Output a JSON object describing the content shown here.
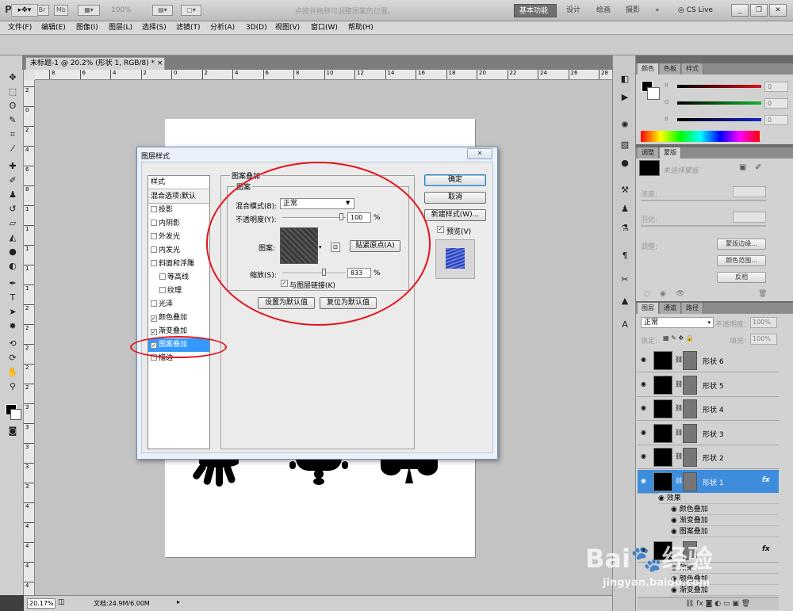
{
  "app": {
    "logo": "Ps",
    "zoom": "100%",
    "workspaces": [
      "基本功能",
      "设计",
      "绘画",
      "摄影",
      "»"
    ],
    "cs_live": "CS Live",
    "window_buttons": [
      "_",
      "❐",
      "✕"
    ]
  },
  "menu": [
    "文件(F)",
    "编辑(E)",
    "图像(I)",
    "图层(L)",
    "选择(S)",
    "滤镜(T)",
    "分析(A)",
    "3D(D)",
    "视图(V)",
    "窗口(W)",
    "帮助(H)"
  ],
  "options": {
    "hint": "点按并拖移可调整图案的位置。"
  },
  "document": {
    "tab_title": "未标题-1 @ 20.2% (形状 1, RGB/8) *",
    "tab_close": "×",
    "ruler_h": [
      "8",
      "6",
      "4",
      "2",
      "0",
      "2",
      "4",
      "6",
      "8",
      "10",
      "12",
      "14",
      "16",
      "18",
      "20",
      "22",
      "24",
      "26",
      "28"
    ],
    "ruler_v": [
      "2",
      "0",
      "2",
      "4",
      "6",
      "8",
      "1",
      "1",
      "1",
      "1",
      "1",
      "2",
      "2",
      "2",
      "2",
      "2",
      "3",
      "3",
      "3",
      "3",
      "3",
      "4",
      "4",
      "4",
      "4",
      "4"
    ],
    "zoom_status": "20.17%",
    "doc_info": "文档:24.9M/6.00M"
  },
  "dialog": {
    "title": "图层样式",
    "close": "✕",
    "styles_header": "样式",
    "blend_default": "混合选项:默认",
    "style_items": [
      {
        "label": "投影",
        "checked": false,
        "indent": false
      },
      {
        "label": "内阴影",
        "checked": false,
        "indent": false
      },
      {
        "label": "外发光",
        "checked": false,
        "indent": false
      },
      {
        "label": "内发光",
        "checked": false,
        "indent": false
      },
      {
        "label": "斜面和浮雕",
        "checked": false,
        "indent": false
      },
      {
        "label": "等高线",
        "checked": false,
        "indent": true
      },
      {
        "label": "纹理",
        "checked": false,
        "indent": true
      },
      {
        "label": "光泽",
        "checked": false,
        "indent": false
      },
      {
        "label": "颜色叠加",
        "checked": true,
        "indent": false
      },
      {
        "label": "渐变叠加",
        "checked": true,
        "indent": false
      },
      {
        "label": "图案叠加",
        "checked": true,
        "indent": false,
        "selected": true
      },
      {
        "label": "描边",
        "checked": false,
        "indent": false
      }
    ],
    "group_title": "图案叠加",
    "subgroup_title": "图案",
    "blend_mode_label": "混合模式(B):",
    "blend_mode_value": "正常",
    "opacity_label": "不透明度(Y):",
    "opacity_value": 100,
    "pattern_label": "图案:",
    "snap_origin": "贴紧原点(A)",
    "scale_label": "缩放(S):",
    "scale_value": 833,
    "percent": "%",
    "link_label": "与图层链接(K)",
    "link_checked": true,
    "set_default": "设置为默认值",
    "reset_default": "复位为默认值",
    "ok": "确定",
    "cancel": "取消",
    "new_style": "新建样式(W)...",
    "preview_label": "预览(V)",
    "preview_checked": true
  },
  "panels": {
    "color_tabs": [
      "颜色",
      "色板",
      "样式"
    ],
    "color_channels": [
      {
        "label": "R",
        "value": "0",
        "color": "#d4151b"
      },
      {
        "label": "G",
        "value": "0",
        "color": "#13b52a"
      },
      {
        "label": "B",
        "value": "0",
        "color": "#1624cc"
      }
    ],
    "adjust_tabs": [
      "调整",
      "蒙版"
    ],
    "mask_hint": "未选择蒙版",
    "density_label": "浓度:",
    "feather_label": "羽化:",
    "refine_label": "调整:",
    "mask_edge": "蒙版边缘...",
    "color_range": "颜色范围...",
    "invert": "反相",
    "layers_tabs": [
      "图层",
      "通道",
      "路径"
    ],
    "layer_blend": "正常",
    "layer_opacity_label": "不透明度:",
    "layer_opacity": "100%",
    "lock_label": "锁定:",
    "fill_label": "填充:",
    "fill_value": "100%",
    "layers": [
      {
        "name": "形状 6",
        "selected": false,
        "fx": false
      },
      {
        "name": "形状 5",
        "selected": false,
        "fx": false
      },
      {
        "name": "形状 4",
        "selected": false,
        "fx": false
      },
      {
        "name": "形状 3",
        "selected": false,
        "fx": false
      },
      {
        "name": "形状 2",
        "selected": false,
        "fx": false
      },
      {
        "name": "形状 1",
        "selected": true,
        "fx": true
      }
    ],
    "effects_label": "效果",
    "effects": [
      "颜色叠加",
      "渐变叠加",
      "图案叠加"
    ],
    "bottom_layer_effects": [
      "效果",
      "颜色叠加",
      "渐变叠加"
    ],
    "fx_symbol": "fx"
  },
  "watermark": {
    "brand": "Bai",
    "brand2": "经验",
    "url": "jingyan.baidu.com"
  },
  "colors": {
    "selection": "#3e8ddd",
    "annotation": "#e3141b"
  }
}
